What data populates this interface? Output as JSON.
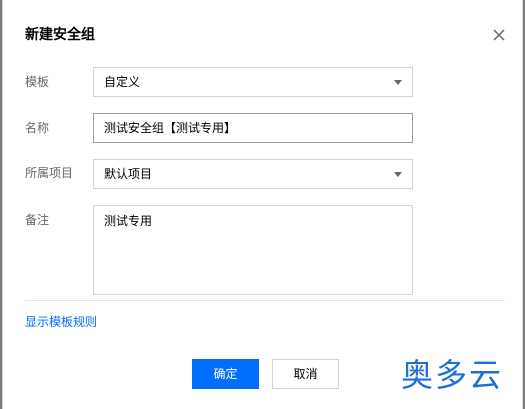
{
  "dialog": {
    "title": "新建安全组",
    "close_icon": "close-icon"
  },
  "form": {
    "template": {
      "label": "模板",
      "value": "自定义"
    },
    "name": {
      "label": "名称",
      "value": "测试安全组【测试专用】"
    },
    "project": {
      "label": "所属项目",
      "value": "默认项目"
    },
    "remark": {
      "label": "备注",
      "value": "测试专用"
    }
  },
  "link": {
    "show_rules": "显示模板规则"
  },
  "buttons": {
    "confirm": "确定",
    "cancel": "取消"
  },
  "watermark": {
    "text": "奥多云"
  },
  "colors": {
    "primary": "#006eff",
    "link": "#006eff",
    "watermark": "#1f6fd6",
    "border": "#cfd5de"
  }
}
